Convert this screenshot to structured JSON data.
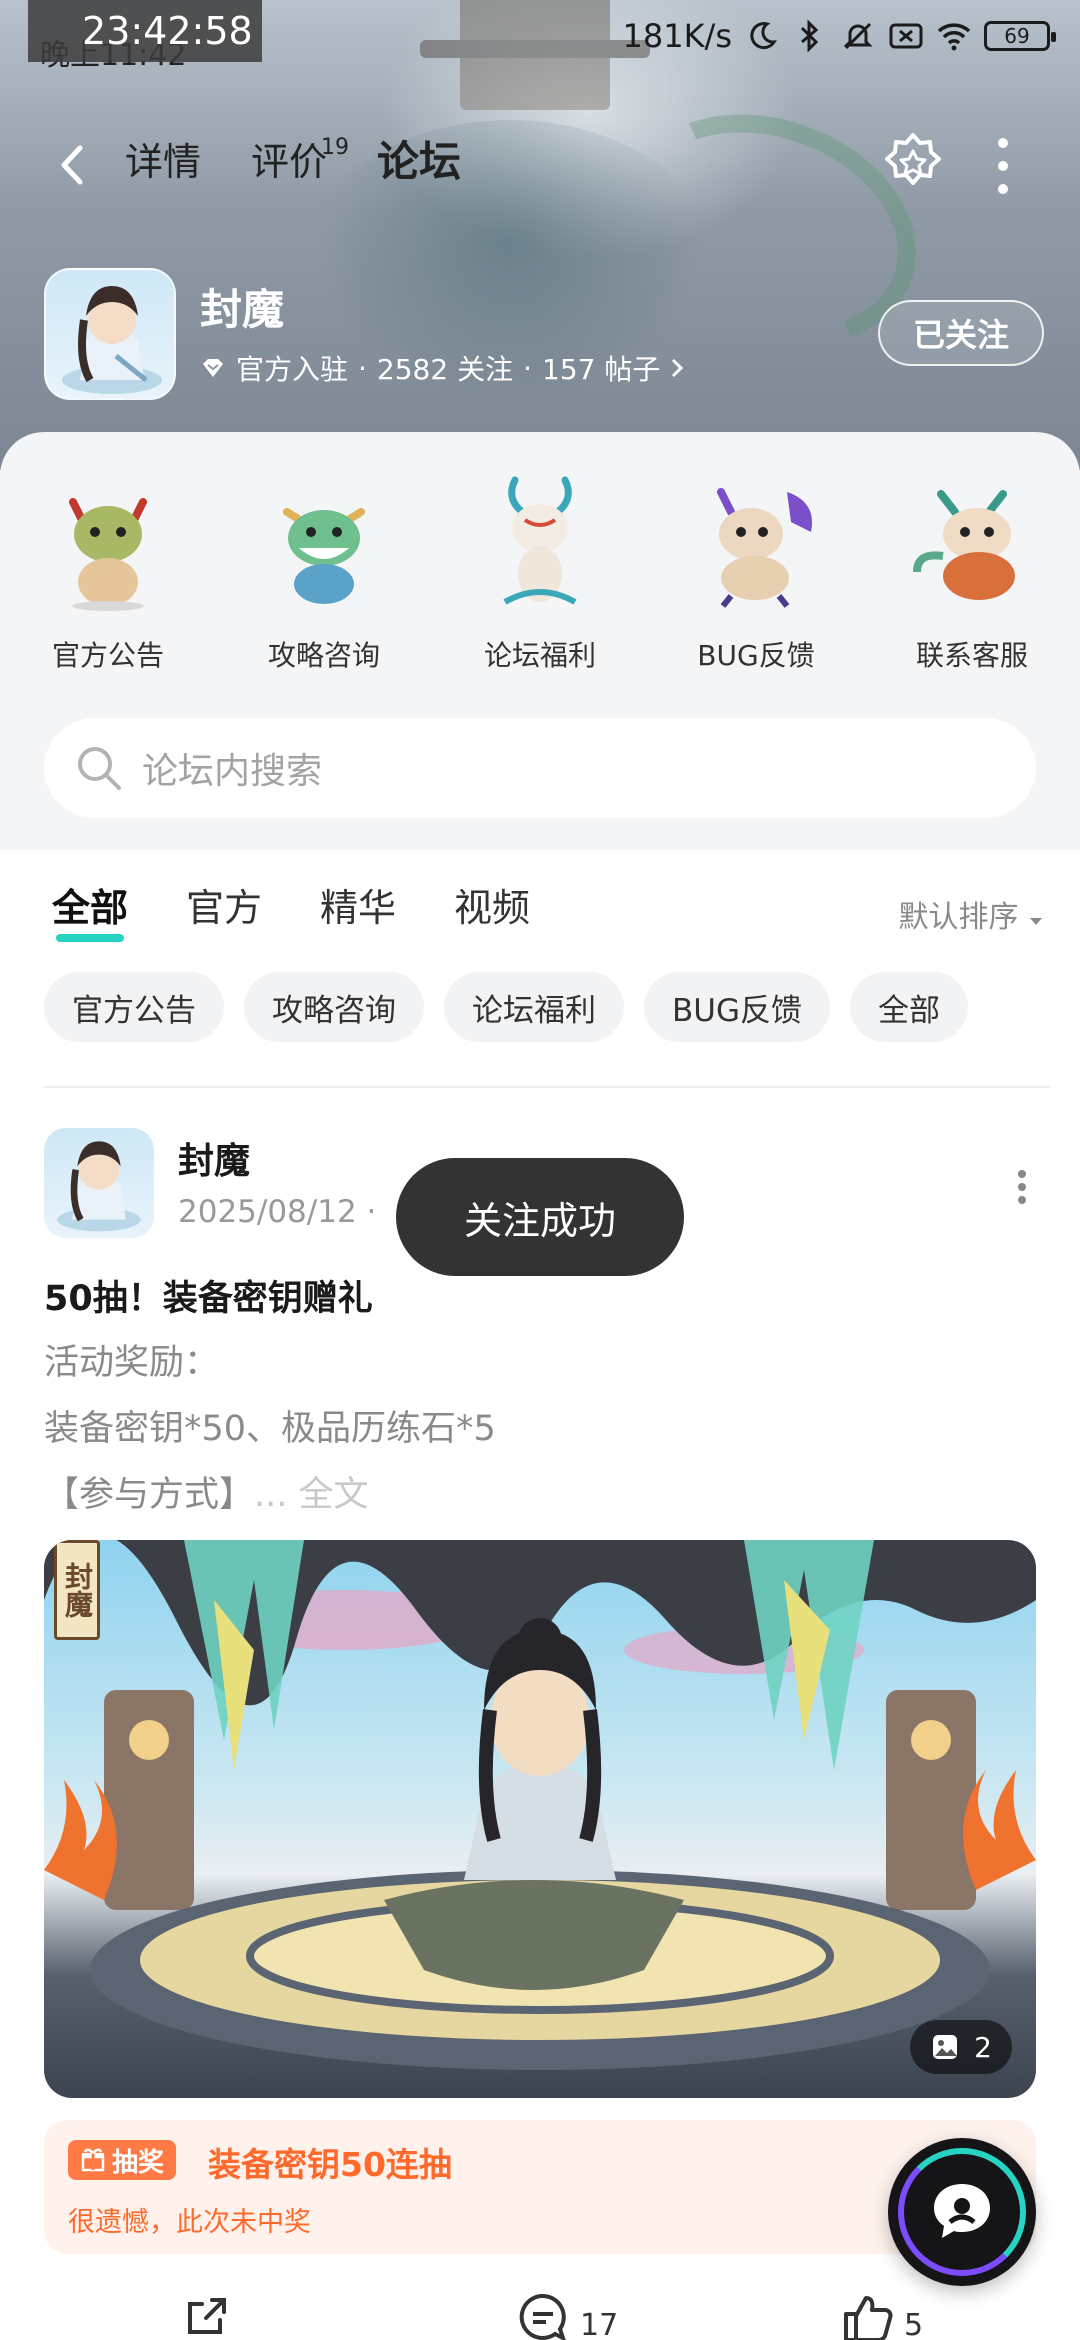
{
  "status_bar": {
    "clock_overlay": "23:42:58",
    "clock_under": "晚上11:42",
    "network_speed": "181K/s",
    "battery": "69"
  },
  "nav": {
    "tabs": [
      {
        "label": "详情",
        "badge": ""
      },
      {
        "label": "评价",
        "badge": "19"
      },
      {
        "label": "论坛",
        "badge": ""
      }
    ],
    "active_tab": "论坛"
  },
  "game": {
    "title": "封魔",
    "official": "官方入驻",
    "followers": "2582 关注",
    "posts": "157 帖子",
    "follow_label": "已关注"
  },
  "categories": [
    {
      "label": "官方公告",
      "color": "#8fa35c"
    },
    {
      "label": "攻略咨询",
      "color": "#5ab08f"
    },
    {
      "label": "论坛福利",
      "color": "#e8e2d6"
    },
    {
      "label": "BUG反馈",
      "color": "#e6d2b8"
    },
    {
      "label": "联系客服",
      "color": "#d6a36b"
    }
  ],
  "search": {
    "placeholder": "论坛内搜索"
  },
  "filter": {
    "tabs": [
      "全部",
      "官方",
      "精华",
      "视频"
    ],
    "active": "全部",
    "sort_label": "默认排序",
    "chips": [
      "官方公告",
      "攻略咨询",
      "论坛福利",
      "BUG反馈",
      "全部"
    ]
  },
  "post": {
    "author": "封魔",
    "date": "2025/08/12",
    "date_sep": "·",
    "toast": "关注成功",
    "title": "50抽！装备密钥赠礼",
    "body_lines": [
      "活动奖励：",
      "装备密钥*50、极品历练石*5",
      "【参与方式】"
    ],
    "more_label": "... 全文",
    "image_count": "2",
    "image_seal": "封魔",
    "lottery": {
      "badge": "抽奖",
      "title": "装备密钥50连抽",
      "subtitle": "很遗憾，此次未中奖"
    },
    "comments": "17",
    "likes": "5"
  },
  "colors": {
    "accent": "#27d4c4",
    "lottery": "#ff6a2c"
  }
}
